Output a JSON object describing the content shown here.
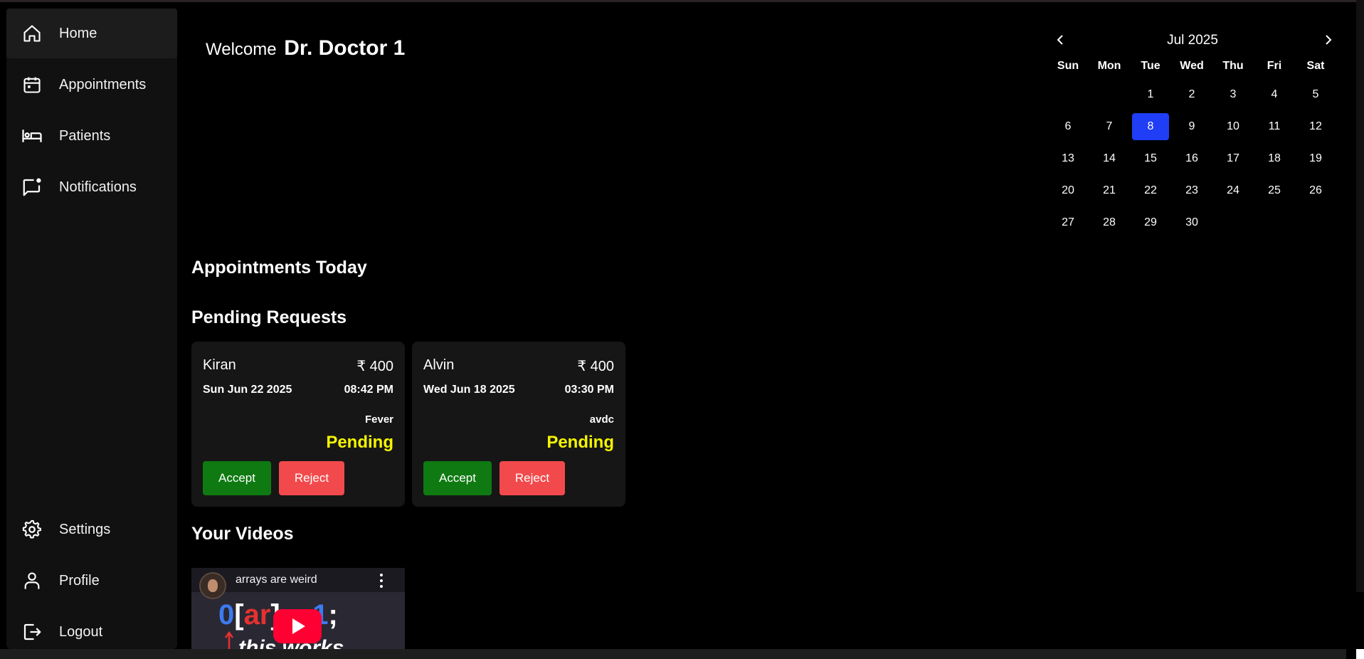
{
  "sidebar": {
    "items": [
      {
        "label": "Home",
        "icon": "home-icon",
        "active": true
      },
      {
        "label": "Appointments",
        "icon": "calendar-icon"
      },
      {
        "label": "Patients",
        "icon": "bed-icon"
      },
      {
        "label": "Notifications",
        "icon": "notification-icon"
      },
      {
        "label": "Settings",
        "icon": "gear-icon"
      },
      {
        "label": "Profile",
        "icon": "user-icon"
      },
      {
        "label": "Logout",
        "icon": "logout-icon"
      }
    ]
  },
  "welcome": {
    "prefix": "Welcome",
    "name": "Dr. Doctor 1"
  },
  "sections": {
    "today": "Appointments Today",
    "pending": "Pending Requests",
    "videos": "Your Videos"
  },
  "calendar": {
    "month": "Jul 2025",
    "weekdays": [
      "Sun",
      "Mon",
      "Tue",
      "Wed",
      "Thu",
      "Fri",
      "Sat"
    ],
    "days": [
      "",
      "",
      "1",
      "2",
      "3",
      "4",
      "5",
      "6",
      "7",
      "8",
      "9",
      "10",
      "11",
      "12",
      "13",
      "14",
      "15",
      "16",
      "17",
      "18",
      "19",
      "20",
      "21",
      "22",
      "23",
      "24",
      "25",
      "26",
      "27",
      "28",
      "29",
      "30"
    ],
    "selected": "8",
    "selected_color": "#1f3ef5"
  },
  "requests": [
    {
      "name": "Kiran",
      "fee": "₹ 400",
      "date": "Sun Jun 22 2025",
      "time": "08:42 PM",
      "reason": "Fever",
      "status": "Pending",
      "accept": "Accept",
      "reject": "Reject"
    },
    {
      "name": "Alvin",
      "fee": "₹ 400",
      "date": "Wed Jun 18 2025",
      "time": "03:30 PM",
      "reason": "avdc",
      "status": "Pending",
      "accept": "Accept",
      "reject": "Reject"
    }
  ],
  "colors": {
    "accept": "#0f7a12",
    "reject": "#f24a4c",
    "pending": "#f4f400"
  },
  "video": {
    "title": "arrays are weird",
    "code_a": "0",
    "code_b": "[ar",
    "code_c": "] = ",
    "code_d": "1",
    "code_e": ";",
    "caption": "this works"
  }
}
